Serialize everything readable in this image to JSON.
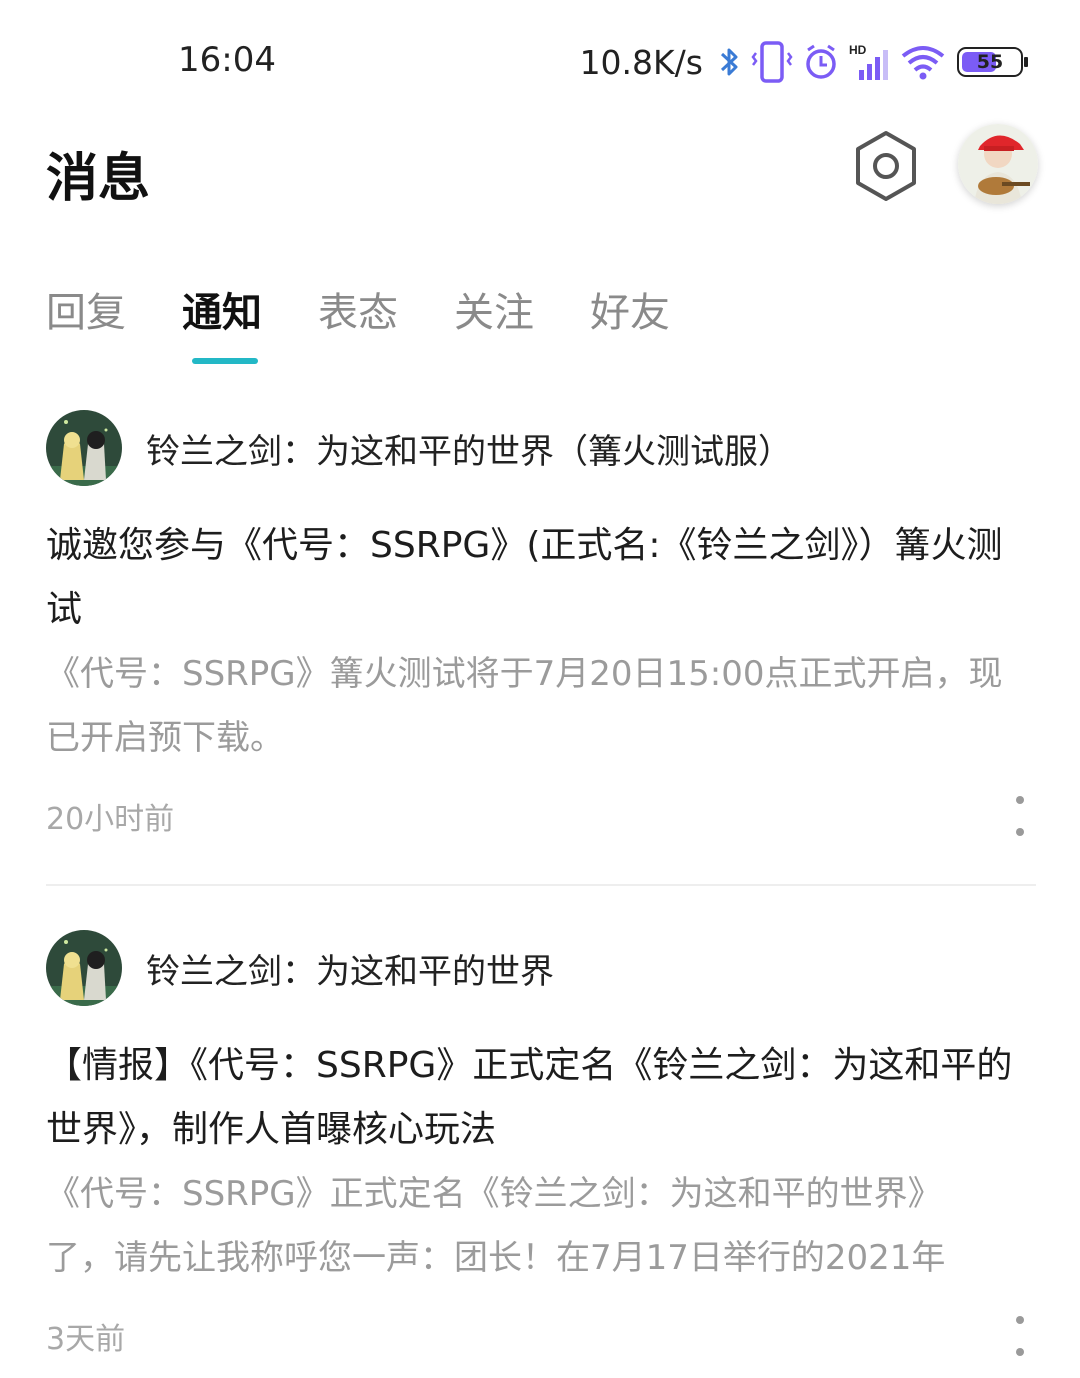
{
  "status_bar": {
    "time": "16:04",
    "net_speed": "10.8K/s",
    "battery": "55",
    "accent": "#7b5cf5"
  },
  "header": {
    "title": "消息",
    "settings_icon": "settings-hexagon-icon",
    "avatar_icon": "user-avatar"
  },
  "tabs": [
    {
      "label": "回复",
      "active": false
    },
    {
      "label": "通知",
      "active": true
    },
    {
      "label": "表态",
      "active": false
    },
    {
      "label": "关注",
      "active": false
    },
    {
      "label": "好友",
      "active": false
    }
  ],
  "tab_accent": "#23b8c6",
  "notifications": [
    {
      "source": "铃兰之剑：为这和平的世界（篝火测试服）",
      "title": "诚邀您参与《代号：SSRPG》(正式名:《铃兰之剑》）篝火测试",
      "desc": "《代号：SSRPG》篝火测试将于7月20日15:00点正式开启，现已开启预下载。",
      "time": "20小时前"
    },
    {
      "source": "铃兰之剑：为这和平的世界",
      "title": "【情报】《代号：SSRPG》正式定名《铃兰之剑：为这和平的世界》，制作人首曝核心玩法",
      "desc_line1": "《代号：SSRPG》正式定名《铃兰之剑：为这和平的世界》",
      "desc_line2": "了，请先让我称呼您一声：团长！在7月17日举行的2021年",
      "time": "3天前"
    }
  ]
}
